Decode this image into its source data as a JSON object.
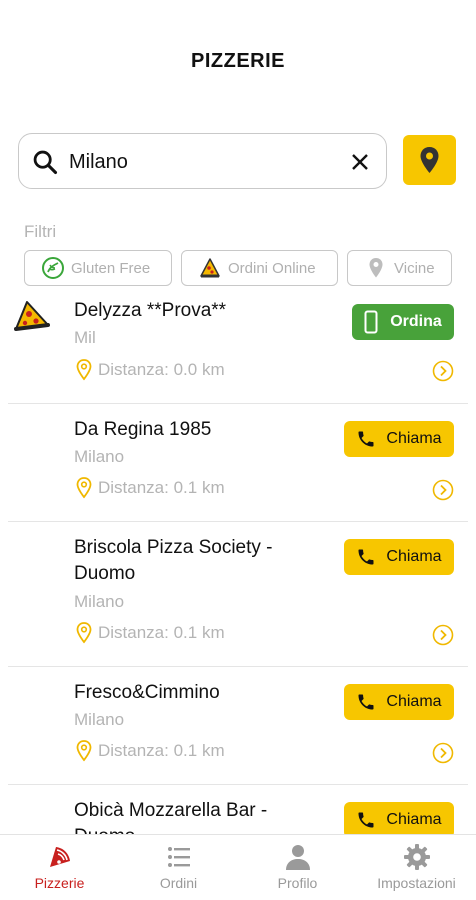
{
  "header": {
    "title": "PIZZERIE"
  },
  "search": {
    "value": "Milano",
    "placeholder": ""
  },
  "filters": {
    "label": "Filtri",
    "chips": [
      {
        "label": "Gluten Free",
        "icon": "gluten-free-icon"
      },
      {
        "label": "Ordini Online",
        "icon": "pizza-slice-icon"
      },
      {
        "label": "Vicine",
        "icon": "location-pin-icon"
      }
    ]
  },
  "pizzerias": [
    {
      "name": "Delyzza **Prova**",
      "city": "Mil",
      "distance": "Distanza: 0.0 km",
      "action": "Ordina",
      "action_type": "order",
      "has_logo": true
    },
    {
      "name": "Da Regina 1985",
      "city": "Milano",
      "distance": "Distanza: 0.1 km",
      "action": "Chiama",
      "action_type": "call"
    },
    {
      "name": "Briscola Pizza Society - Duomo",
      "city": "Milano",
      "distance": "Distanza: 0.1 km",
      "action": "Chiama",
      "action_type": "call"
    },
    {
      "name": "Fresco&Cimmino",
      "city": "Milano",
      "distance": "Distanza: 0.1 km",
      "action": "Chiama",
      "action_type": "call"
    },
    {
      "name": "Obicà Mozzarella Bar - Duomo",
      "city": "",
      "distance": "",
      "action": "Chiama",
      "action_type": "call"
    }
  ],
  "tabs": [
    {
      "label": "Pizzerie",
      "icon": "pizza-icon",
      "active": true
    },
    {
      "label": "Ordini",
      "icon": "list-icon",
      "active": false
    },
    {
      "label": "Profilo",
      "icon": "person-icon",
      "active": false
    },
    {
      "label": "Impostazioni",
      "icon": "gear-icon",
      "active": false
    }
  ],
  "colors": {
    "accent": "#f7c600",
    "order_green": "#48a23a",
    "active_tab": "#c8201e",
    "muted": "#b4b4b4"
  }
}
